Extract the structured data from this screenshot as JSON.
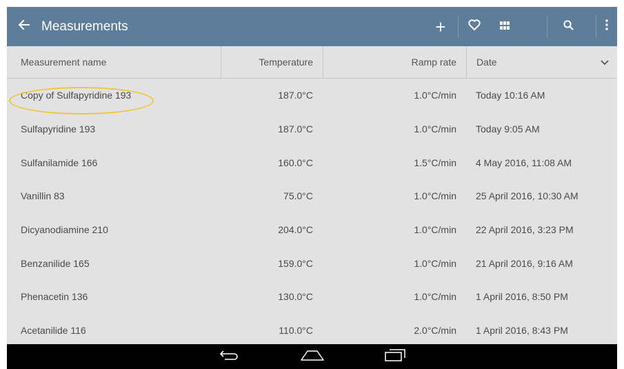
{
  "toolbar": {
    "title": "Measurements",
    "add_label": "+",
    "icons": [
      "arrow-left-icon",
      "plus-icon",
      "heart-icon",
      "grid-icon",
      "search-icon",
      "more-vert-icon"
    ],
    "background_color": "#5e7d99"
  },
  "table": {
    "columns": [
      "Measurement name",
      "Temperature",
      "Ramp rate",
      "Date"
    ],
    "rows": [
      {
        "name": "Copy of Sulfapyridine 193",
        "temperature": "187.0°C",
        "ramp_rate": "1.0°C/min",
        "date": "Today 10:16 AM"
      },
      {
        "name": "Sulfapyridine 193",
        "temperature": "187.0°C",
        "ramp_rate": "1.0°C/min",
        "date": "Today 9:05 AM"
      },
      {
        "name": "Sulfanilamide 166",
        "temperature": "160.0°C",
        "ramp_rate": "1.5°C/min",
        "date": "4 May 2016, 11:08 AM"
      },
      {
        "name": "Vanillin 83",
        "temperature": "75.0°C",
        "ramp_rate": "1.0°C/min",
        "date": "25 April 2016, 10:30 AM"
      },
      {
        "name": "Dicyanodiamine 210",
        "temperature": "204.0°C",
        "ramp_rate": "1.0°C/min",
        "date": "22 April 2016, 3:23 PM"
      },
      {
        "name": "Benzanilide 165",
        "temperature": "159.0°C",
        "ramp_rate": "1.0°C/min",
        "date": "21 April 2016, 9:16 AM"
      },
      {
        "name": "Phenacetin 136",
        "temperature": "130.0°C",
        "ramp_rate": "1.0°C/min",
        "date": "1 April 2016, 8:50 PM"
      },
      {
        "name": "Acetanilide 116",
        "temperature": "110.0°C",
        "ramp_rate": "2.0°C/min",
        "date": "1 April 2016, 8:43 PM"
      }
    ],
    "highlight_color": "#f2c53d"
  },
  "navbar": {
    "icons": [
      "nav-back-icon",
      "nav-home-icon",
      "nav-recents-icon"
    ]
  }
}
